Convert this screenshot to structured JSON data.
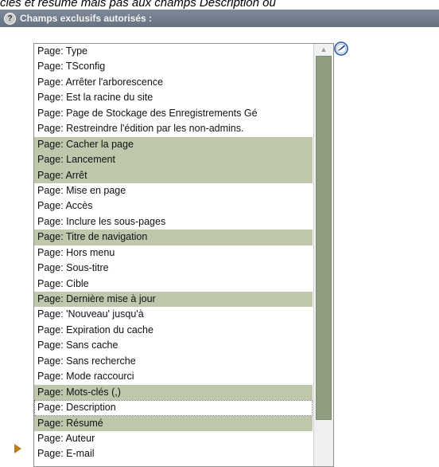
{
  "top_caption": "clés et résumé mais pas aux champs Description ou",
  "header": {
    "help_icon_label": "?",
    "title": "Champs exclusifs autorisés :"
  },
  "icons": {
    "help": "help-icon",
    "wizard": "wizard-clock-icon",
    "scroll_up": "scroll-up-arrow-icon",
    "marker": "play-arrow-icon"
  },
  "colors": {
    "header_bar": "#6f7b89",
    "selected_row": "#bfc7ad",
    "scrollbar_thumb": "#8e9e7f",
    "arrow_marker": "#c07a17"
  },
  "list": {
    "items": [
      {
        "label": "Page: Type",
        "selected": false
      },
      {
        "label": "Page: TSconfig",
        "selected": false
      },
      {
        "label": "Page: Arrêter l'arborescence",
        "selected": false
      },
      {
        "label": "Page: Est la racine du site",
        "selected": false
      },
      {
        "label": "Page: Page de Stockage des Enregistrements Gé",
        "selected": false
      },
      {
        "label": "Page: Restreindre l'édition par les non-admins.",
        "selected": false
      },
      {
        "label": "Page: Cacher la page",
        "selected": true
      },
      {
        "label": "Page: Lancement",
        "selected": true
      },
      {
        "label": "Page: Arrêt",
        "selected": true
      },
      {
        "label": "Page: Mise en page",
        "selected": false
      },
      {
        "label": "Page: Accès",
        "selected": false
      },
      {
        "label": "Page: Inclure les sous-pages",
        "selected": false
      },
      {
        "label": "Page: Titre de navigation",
        "selected": true
      },
      {
        "label": "Page: Hors menu",
        "selected": false
      },
      {
        "label": "Page: Sous-titre",
        "selected": false
      },
      {
        "label": "Page: Cible",
        "selected": false
      },
      {
        "label": "Page: Dernière mise à jour",
        "selected": true
      },
      {
        "label": "Page: 'Nouveau' jusqu'à",
        "selected": false
      },
      {
        "label": "Page: Expiration du cache",
        "selected": false
      },
      {
        "label": "Page: Sans cache",
        "selected": false
      },
      {
        "label": "Page: Sans recherche",
        "selected": false
      },
      {
        "label": "Page: Mode raccourci",
        "selected": false
      },
      {
        "label": "Page: Mots-clés (,)",
        "selected": true
      },
      {
        "label": "Page: Description",
        "selected": false,
        "focused": true
      },
      {
        "label": "Page: Résumé",
        "selected": true
      },
      {
        "label": "Page: Auteur",
        "selected": false
      },
      {
        "label": "Page: E-mail",
        "selected": false
      }
    ]
  }
}
